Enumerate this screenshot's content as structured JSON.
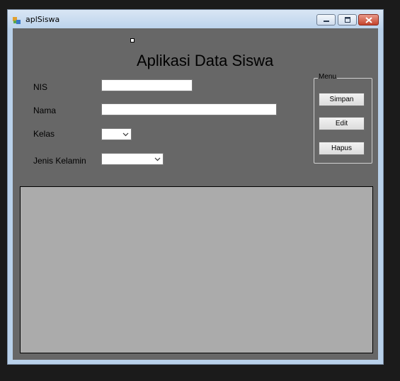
{
  "window": {
    "title": "aplSiswa"
  },
  "form": {
    "heading": "Aplikasi Data Siswa",
    "fields": {
      "nis_label": "NIS",
      "nama_label": "Nama",
      "kelas_label": "Kelas",
      "jenis_kelamin_label": "Jenis Kelamin"
    },
    "menu": {
      "legend": "Menu",
      "simpan": "Simpan",
      "edit": "Edit",
      "hapus": "Hapus"
    }
  },
  "colors": {
    "form_background": "#676767",
    "grid_background": "#ababab",
    "close_button": "#c4432b"
  }
}
